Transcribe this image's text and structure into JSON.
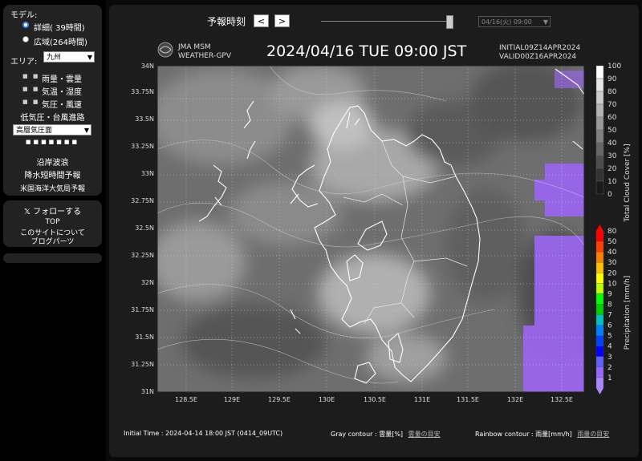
{
  "sidebar": {
    "model_label": "モデル:",
    "model_options": [
      {
        "label": "詳細( 39時間)",
        "selected": true
      },
      {
        "label": "広域(264時間)",
        "selected": false
      }
    ],
    "area_label": "エリア:",
    "area_value": "九州",
    "layers": [
      "雨量・雲量",
      "気温・湿度",
      "気圧・風速"
    ],
    "typhoon_label": "低気圧・台風進路",
    "upper_select": "高層気圧面",
    "upper_dots": "■■■■■■■",
    "links": [
      "沿岸波浪",
      "降水短時間予報",
      "米国海洋大気局予報"
    ],
    "follow_label": "𝕏 フォローする",
    "footer_links": [
      "TOP",
      "このサイトについて",
      "ブログパーツ"
    ]
  },
  "toolbar": {
    "forecast_label": "予報時刻",
    "prev_label": "<",
    "next_label": ">",
    "date_select": "04/16(火) 09:00"
  },
  "map": {
    "logo_line1": "JMA MSM",
    "logo_line2": "WEATHER-GPV",
    "datetime": "2024/04/16  TUE  09:00 JST",
    "initial_code": "INITIAL09Z14APR2024",
    "valid_code": "VALID00Z16APR2024",
    "lat_labels": [
      "34N",
      "33.75N",
      "33.5N",
      "33.25N",
      "33N",
      "32.75N",
      "32.5N",
      "32.25N",
      "32N",
      "31.75N",
      "31.5N",
      "31.25N",
      "31N"
    ],
    "lon_labels": [
      "128.5E",
      "129E",
      "129.5E",
      "130E",
      "130.5E",
      "131E",
      "131.5E",
      "132E",
      "132.5E"
    ],
    "cloud_legend": {
      "title": "Total Cloud Cover [%]",
      "ticks": [
        "100",
        "90",
        "80",
        "70",
        "60",
        "50",
        "40",
        "30",
        "20",
        "10",
        "0"
      ],
      "colors": [
        "#ffffff",
        "#e6e6e6",
        "#cccccc",
        "#b3b3b3",
        "#999999",
        "#808080",
        "#666666",
        "#4d4d4d",
        "#333333",
        "#1a1a1a"
      ]
    },
    "precip_legend": {
      "title": "Precipitation [mm/h]",
      "ticks": [
        "80",
        "50",
        "40",
        "30",
        "20",
        "10",
        "9",
        "8",
        "7",
        "6",
        "5",
        "4",
        "3",
        "2",
        "1"
      ],
      "colors": [
        "#ff0000",
        "#ff4000",
        "#ff8000",
        "#ffc000",
        "#ffff00",
        "#c0ff00",
        "#00ff00",
        "#00d000",
        "#00c0c0",
        "#0080ff",
        "#0040ff",
        "#0000ff",
        "#6060ff",
        "#9966ff",
        "#aa88ff"
      ]
    },
    "precip_color": "#9966ee"
  },
  "footer": {
    "initial_time": "Initial Time : 2024-04-14 18:00 JST (0414_09UTC)",
    "gray_label": "Gray contour : 雲量[%]",
    "gray_link": "雲量の目安",
    "rainbow_label": "Rainbow contour : 雨量[mm/h]",
    "rainbow_link": "雨量の目安"
  }
}
